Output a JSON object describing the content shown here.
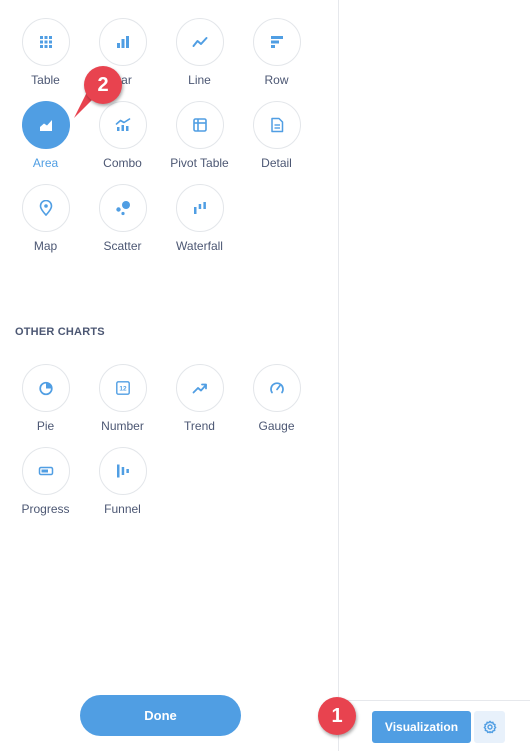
{
  "chart_types": {
    "main": [
      {
        "label": "Table",
        "icon": "table-icon",
        "selected": false
      },
      {
        "label": "Bar",
        "icon": "bar-chart-icon",
        "selected": false
      },
      {
        "label": "Line",
        "icon": "line-chart-icon",
        "selected": false
      },
      {
        "label": "Row",
        "icon": "row-chart-icon",
        "selected": false
      },
      {
        "label": "Area",
        "icon": "area-chart-icon",
        "selected": true
      },
      {
        "label": "Combo",
        "icon": "combo-chart-icon",
        "selected": false
      },
      {
        "label": "Pivot Table",
        "icon": "pivot-table-icon",
        "selected": false
      },
      {
        "label": "Detail",
        "icon": "detail-icon",
        "selected": false
      },
      {
        "label": "Map",
        "icon": "map-pin-icon",
        "selected": false
      },
      {
        "label": "Scatter",
        "icon": "scatter-icon",
        "selected": false
      },
      {
        "label": "Waterfall",
        "icon": "waterfall-icon",
        "selected": false
      }
    ],
    "other_title": "OTHER CHARTS",
    "other": [
      {
        "label": "Pie",
        "icon": "pie-chart-icon",
        "selected": false
      },
      {
        "label": "Number",
        "icon": "number-icon",
        "selected": false
      },
      {
        "label": "Trend",
        "icon": "trend-icon",
        "selected": false
      },
      {
        "label": "Gauge",
        "icon": "gauge-icon",
        "selected": false
      },
      {
        "label": "Progress",
        "icon": "progress-icon",
        "selected": false
      },
      {
        "label": "Funnel",
        "icon": "funnel-icon",
        "selected": false
      }
    ]
  },
  "footer": {
    "done_label": "Done",
    "visualization_label": "Visualization",
    "settings_icon": "gear-icon"
  },
  "annotations": {
    "badge_1": "1",
    "badge_2": "2"
  },
  "number_icon_text": "12",
  "colors": {
    "accent": "#509ee3",
    "text": "#4c5773",
    "border": "#e3e6ea",
    "badge": "#e8434f"
  }
}
